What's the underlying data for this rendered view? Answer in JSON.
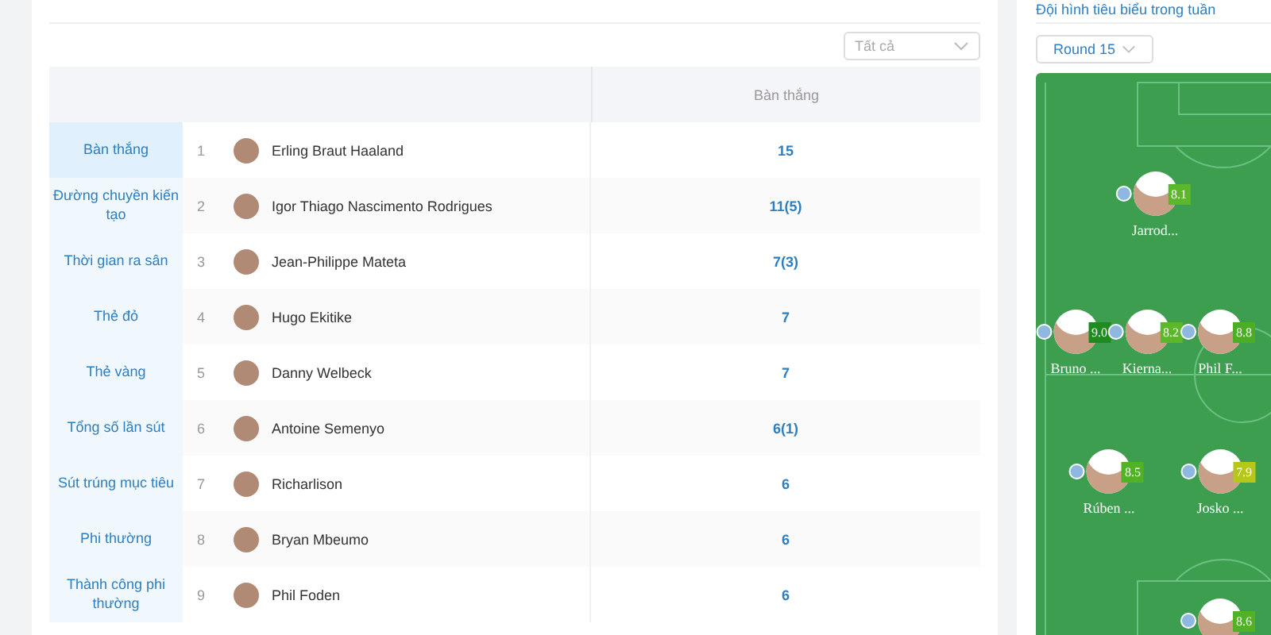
{
  "stats_panel": {
    "filter": {
      "value": "Tất cả"
    },
    "table": {
      "columns": [
        "Bàn thắng"
      ],
      "rows": [
        {
          "category": "Bàn thắng",
          "selected": true,
          "rank": "1",
          "player": "Erling Braut Haaland",
          "value": "15"
        },
        {
          "category": "Đường chuyền kiến tạo",
          "selected": false,
          "rank": "2",
          "player": "Igor Thiago Nascimento Rodrigues",
          "value": "11(5)"
        },
        {
          "category": "Thời gian ra sân",
          "selected": false,
          "rank": "3",
          "player": "Jean-Philippe Mateta",
          "value": "7(3)"
        },
        {
          "category": "Thẻ đỏ",
          "selected": false,
          "rank": "4",
          "player": "Hugo Ekitike",
          "value": "7"
        },
        {
          "category": "Thẻ vàng",
          "selected": false,
          "rank": "5",
          "player": "Danny Welbeck",
          "value": "7"
        },
        {
          "category": "Tổng số lần sút",
          "selected": false,
          "rank": "6",
          "player": "Antoine Semenyo",
          "value": "6(1)"
        },
        {
          "category": "Sút trúng mục tiêu",
          "selected": false,
          "rank": "7",
          "player": "Richarlison",
          "value": "6"
        },
        {
          "category": "Phi thường",
          "selected": false,
          "rank": "8",
          "player": "Bryan Mbeumo",
          "value": "6"
        },
        {
          "category": "Thành công phi thường",
          "selected": false,
          "rank": "9",
          "player": "Phil Foden",
          "value": "6"
        }
      ]
    }
  },
  "team_panel": {
    "title": "Đội hình tiêu biểu trong tuần",
    "round": "Round 15",
    "players": [
      {
        "name": "Jarrod...",
        "rating": "8.1",
        "color": "#5cb82a"
      },
      {
        "name": "Bruno ...",
        "rating": "9.0",
        "color": "#1f8a1f"
      },
      {
        "name": "Kierna...",
        "rating": "8.2",
        "color": "#5cb82a"
      },
      {
        "name": "Phil F...",
        "rating": "8.8",
        "color": "#4cae24"
      },
      {
        "name": "Rúben ...",
        "rating": "8.5",
        "color": "#52b226"
      },
      {
        "name": "Josko ...",
        "rating": "7.9",
        "color": "#b5c817"
      },
      {
        "rating": "8.6",
        "color": "#52b226"
      }
    ]
  }
}
